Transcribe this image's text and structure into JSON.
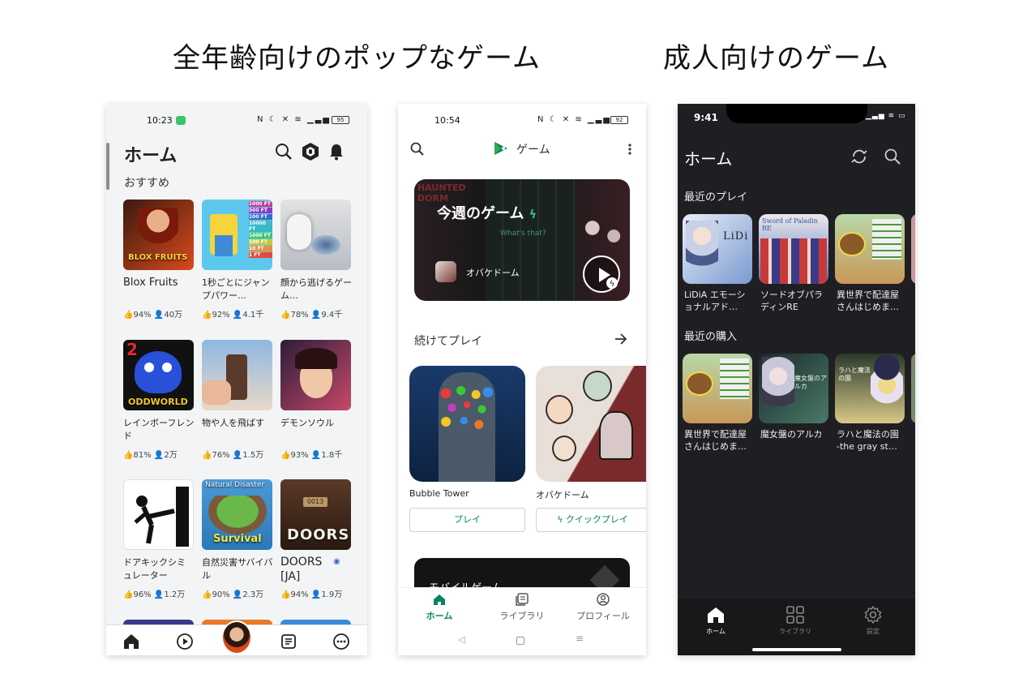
{
  "headings": {
    "left": "全年齢向けのポップなゲーム",
    "right": "成人向けのゲーム"
  },
  "roblox": {
    "status_time": "10:23",
    "battery": "95",
    "title": "ホーム",
    "section": "おすすめ",
    "games": [
      {
        "title": "Blox Fruits",
        "like": "94%",
        "players": "40万",
        "colors": [
          "#3a1a10",
          "#d94a1c"
        ]
      },
      {
        "title": "1秒ごとにジャンプパワー…",
        "like": "92%",
        "players": "4.1千",
        "colors": [
          "#5cc8ee",
          "#f5d43c"
        ]
      },
      {
        "title": "顔から逃げるゲーム…",
        "like": "78%",
        "players": "9.4千",
        "colors": [
          "#d8d8d8",
          "#8aa0b8"
        ]
      },
      {
        "title": "レインボーフレンド",
        "like": "81%",
        "players": "2万",
        "colors": [
          "#111111",
          "#2850d8"
        ]
      },
      {
        "title": "物や人を飛ばす",
        "like": "76%",
        "players": "1.5万",
        "colors": [
          "#8fb8e0",
          "#6a4a2a"
        ]
      },
      {
        "title": "デモンソウル",
        "like": "93%",
        "players": "1.8千",
        "colors": [
          "#2a1d3a",
          "#c9486a"
        ]
      },
      {
        "title": "ドアキックシミュレーター",
        "like": "96%",
        "players": "1.2万",
        "colors": [
          "#ffffff",
          "#d8d8d8"
        ]
      },
      {
        "title": "自然災害サバイバル",
        "like": "90%",
        "players": "2.3万",
        "colors": [
          "#4a9ad8",
          "#4a9a3a"
        ]
      },
      {
        "title": "DOORS [JA]",
        "like": "94%",
        "players": "1.9万",
        "colors": [
          "#3a2418",
          "#7a4a2a"
        ]
      }
    ],
    "tile_texts": {
      "bloxfruits": "BLOX FRUITS",
      "oddworld": "ODDWORLD",
      "num2": "2",
      "disaster_top": "Natural Disaster",
      "disaster_bottom": "Survival",
      "doors": "DOORS",
      "door_number": "0013",
      "ft_labels": [
        "1000 FT",
        "500 FT",
        "100 FT",
        "10000 FT",
        "1000 FT",
        "100 FT",
        "10 FT",
        "1 FT"
      ]
    }
  },
  "playgames": {
    "status_time": "10:54",
    "battery": "92",
    "app_title": "ゲーム",
    "featured_title": "今週のゲーム",
    "featured_game": "オバケドーム",
    "featured_sub": "What's that?",
    "featured_bg_text": "HAUNTED DORM",
    "continue_title": "続けてプレイ",
    "cards": [
      {
        "title": "Bubble Tower",
        "button": "プレイ"
      },
      {
        "title": "オバケドーム",
        "button": "クイックプレイ"
      }
    ],
    "bottom_card_text": "モバイルゲーム",
    "nav": [
      {
        "label": "ホーム"
      },
      {
        "label": "ライブラリ"
      },
      {
        "label": "プロフィール"
      }
    ],
    "accent": "#01875f"
  },
  "dlsite": {
    "status_time": "9:41",
    "title": "ホーム",
    "recent_play_title": "最近のプレイ",
    "recent_play": [
      {
        "title": "LiDiA エモーショナルアド…",
        "colors": [
          "#e8eef8",
          "#7a9ad0"
        ],
        "logo": "LiDi"
      },
      {
        "title": "ソードオブパラディンRE",
        "colors": [
          "#f0e8e8",
          "#4878c8"
        ],
        "logo": "Sword of Paladin RE"
      },
      {
        "title": "異世界で配達屋さんはじめま…",
        "colors": [
          "#b8d8a8",
          "#c89858"
        ],
        "logo": ""
      }
    ],
    "recent_buy_title": "最近の購入",
    "recent_buy": [
      {
        "title": "異世界で配達屋さんはじめま…",
        "colors": [
          "#b8d8a8",
          "#c89858"
        ],
        "logo": ""
      },
      {
        "title": "魔女盤のアルカ",
        "colors": [
          "#1a2a2a",
          "#4a7a68"
        ],
        "logo": "魔女盤のアルカ"
      },
      {
        "title": "ラハと魔法の園 -the gray st…",
        "colors": [
          "#2a3a2a",
          "#d8c888"
        ],
        "logo": "ラハと魔法の園"
      }
    ],
    "nav": [
      {
        "label": "ホーム"
      },
      {
        "label": "ライブラリ"
      },
      {
        "label": "設定"
      }
    ]
  }
}
